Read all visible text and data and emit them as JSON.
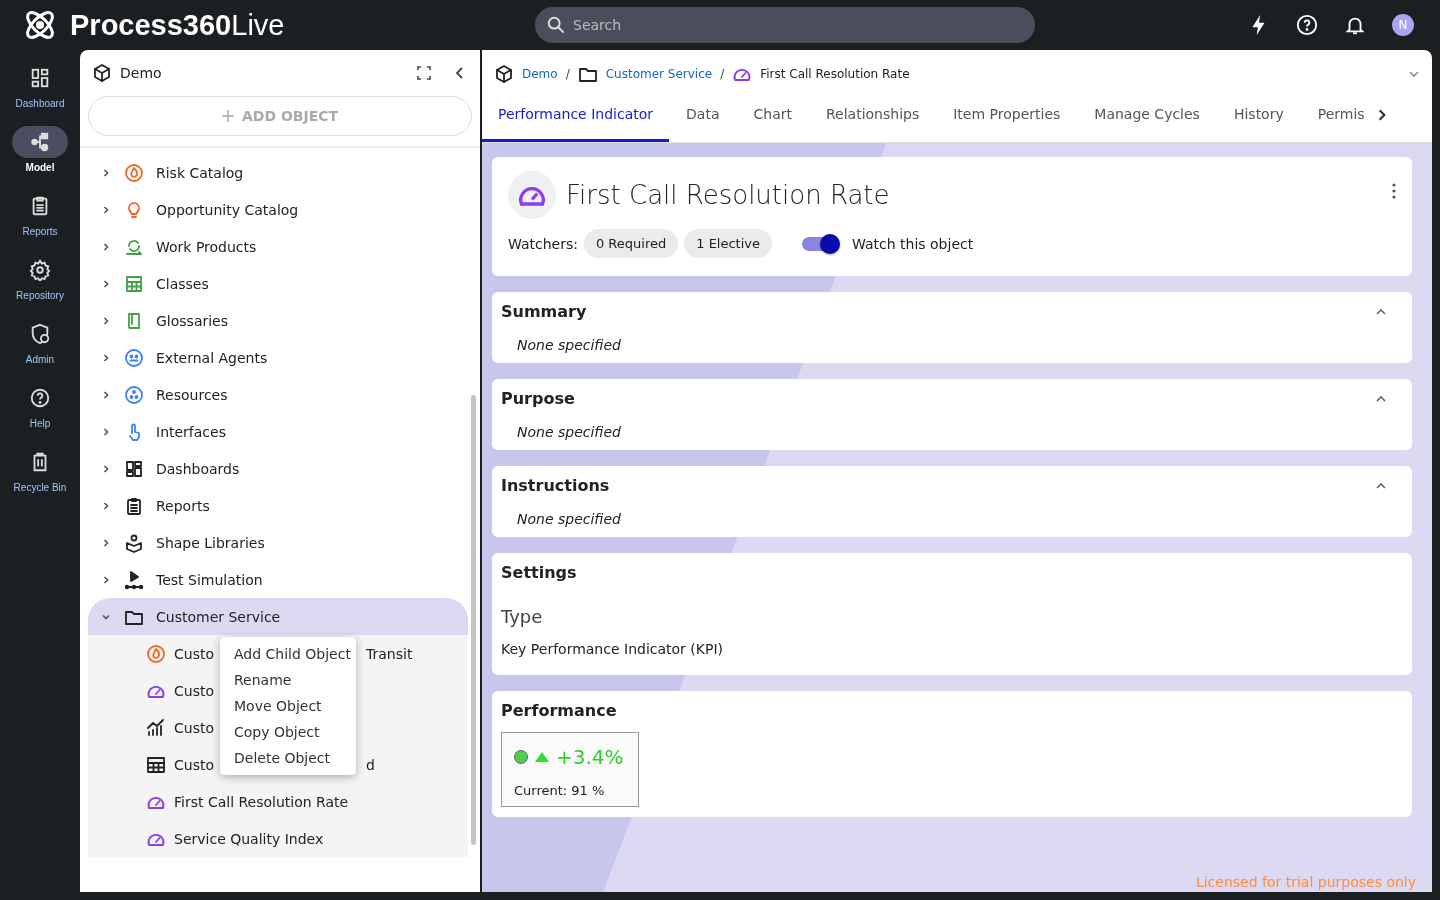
{
  "app": {
    "logo_text_bold": "Process360",
    "logo_text_light": "Live",
    "search": {
      "placeholder": "Search"
    },
    "avatar": "N"
  },
  "nav": [
    {
      "label": "Dashboard",
      "kind": "dashboard",
      "selected": false
    },
    {
      "label": "Model",
      "kind": "model",
      "selected": true
    },
    {
      "label": "Reports",
      "kind": "reports",
      "selected": false
    },
    {
      "label": "Repository",
      "kind": "gear",
      "selected": false
    },
    {
      "label": "Admin",
      "kind": "admin",
      "selected": false
    },
    {
      "label": "Help",
      "kind": "help",
      "selected": false
    },
    {
      "label": "Recycle Bin",
      "kind": "trash",
      "selected": false
    }
  ],
  "tree_panel": {
    "title": "Demo",
    "add_button": "ADD OBJECT",
    "items": [
      {
        "label": "Risk Catalog",
        "kind": "risk",
        "expanded": false,
        "selected": false
      },
      {
        "label": "Opportunity Catalog",
        "kind": "opportunity",
        "expanded": false,
        "selected": false
      },
      {
        "label": "Work Products",
        "kind": "work",
        "expanded": false,
        "selected": false
      },
      {
        "label": "Classes",
        "kind": "classes",
        "expanded": false,
        "selected": false
      },
      {
        "label": "Glossaries",
        "kind": "glossary",
        "expanded": false,
        "selected": false
      },
      {
        "label": "External Agents",
        "kind": "agents",
        "expanded": false,
        "selected": false
      },
      {
        "label": "Resources",
        "kind": "resources",
        "expanded": false,
        "selected": false
      },
      {
        "label": "Interfaces",
        "kind": "interfaces",
        "expanded": false,
        "selected": false
      },
      {
        "label": "Dashboards",
        "kind": "dashboards",
        "expanded": false,
        "selected": false
      },
      {
        "label": "Reports",
        "kind": "reports",
        "expanded": false,
        "selected": false
      },
      {
        "label": "Shape Libraries",
        "kind": "shapes",
        "expanded": false,
        "selected": false
      },
      {
        "label": "Test Simulation",
        "kind": "simulation",
        "expanded": false,
        "selected": false
      },
      {
        "label": "Customer Service",
        "kind": "folder",
        "expanded": true,
        "selected": true,
        "children": [
          {
            "label": "Custo",
            "label_end": "Transit",
            "kind": "risk"
          },
          {
            "label": "Custo",
            "kind": "kpi"
          },
          {
            "label": "Custo",
            "kind": "chart"
          },
          {
            "label": "Custo",
            "label_end": "d",
            "kind": "table"
          },
          {
            "label": "First Call Resolution Rate",
            "kind": "kpi"
          },
          {
            "label": "Service Quality Index",
            "kind": "kpi"
          }
        ]
      }
    ]
  },
  "context_menu": [
    "Add Child Object",
    "Rename",
    "Move Object",
    "Copy Object",
    "Delete Object"
  ],
  "breadcrumb": [
    {
      "label": "Demo",
      "kind": "cube",
      "separator": "/"
    },
    {
      "label": "Customer Service",
      "kind": "folder",
      "separator": "/"
    },
    {
      "label": "First Call Resolution Rate",
      "kind": "kpi"
    }
  ],
  "tabs": [
    {
      "label": "Performance Indicator",
      "selected": true
    },
    {
      "label": "Data",
      "selected": false
    },
    {
      "label": "Chart",
      "selected": false
    },
    {
      "label": "Relationships",
      "selected": false
    },
    {
      "label": "Item Properties",
      "selected": false
    },
    {
      "label": "Manage Cycles",
      "selected": false
    },
    {
      "label": "History",
      "selected": false
    },
    {
      "label": "Permis",
      "selected": false
    }
  ],
  "object": {
    "title": "First Call Resolution Rate",
    "watchers_label": "Watchers:",
    "watchers": [
      "0 Required",
      "1 Elective"
    ],
    "watch_toggle": {
      "label": "Watch this object",
      "on": true
    }
  },
  "sections": [
    {
      "title": "Summary",
      "kind": "text",
      "expanded": true,
      "text": "None specified"
    },
    {
      "title": "Purpose",
      "kind": "text",
      "expanded": true,
      "text": "None specified"
    },
    {
      "title": "Instructions",
      "kind": "text",
      "expanded": true,
      "text": "None specified"
    },
    {
      "title": "Settings",
      "kind": "fields",
      "field_label": "Type",
      "field_value": "Key Performance Indicator (KPI)"
    },
    {
      "title": "Performance",
      "kind": "performance",
      "color": "#4cd14c",
      "trend_up": true,
      "change": "+3.4%",
      "current": "Current: 91 %"
    }
  ],
  "license_note": "Licensed for trial purposes only"
}
